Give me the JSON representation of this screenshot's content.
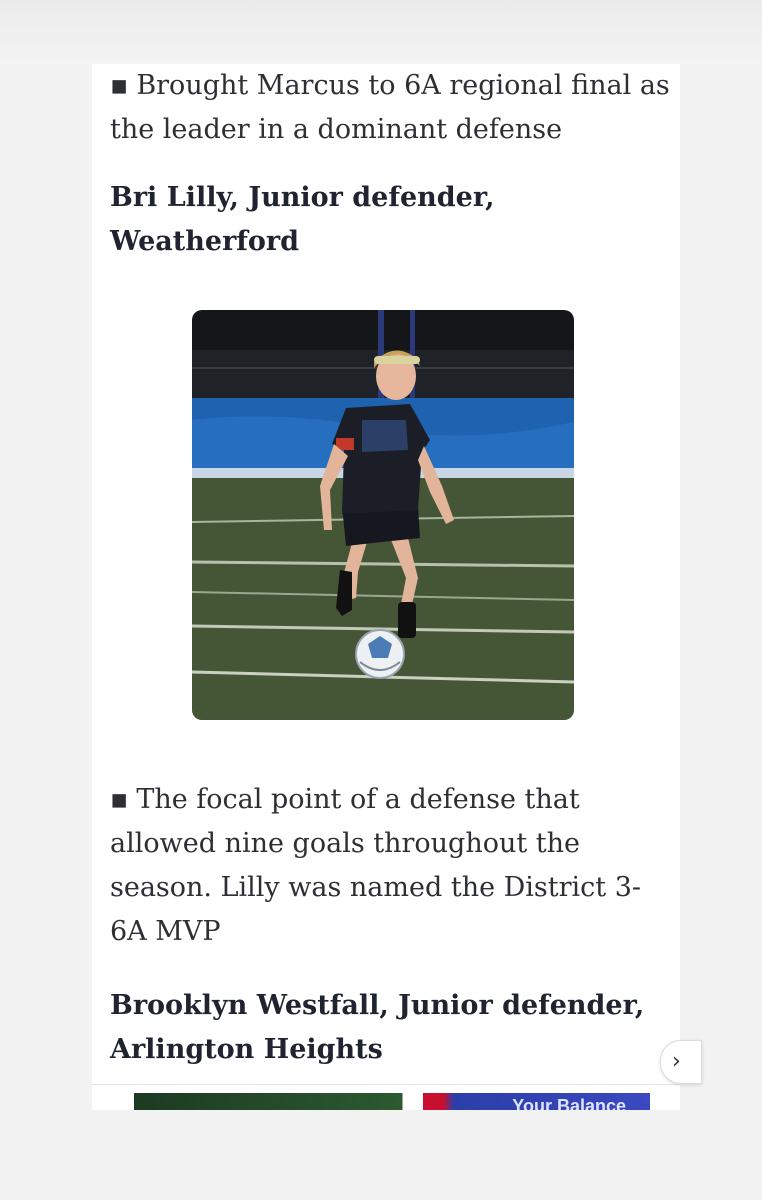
{
  "article": {
    "bullet_glyph": "▪",
    "paragraph_1": "Brought Marcus to 6A regional final as the leader in a dominant defense",
    "heading_1": "Bri Lilly, Junior defender, Weatherford",
    "paragraph_2": "The focal point of a defense that allowed nine goals throughout the season. Lilly was named the District 3-6A MVP",
    "heading_2": "Brooklyn Westfall, Junior defender, Arlington Heights"
  },
  "photo": {
    "subject": "soccer player dribbling ball at night game"
  },
  "ad": {
    "partial_text": "Your Balance"
  },
  "next_button": {
    "glyph": "›"
  },
  "colors": {
    "text": "#2d2f33",
    "heading": "#1f2430",
    "background": "#f2f2f2"
  }
}
